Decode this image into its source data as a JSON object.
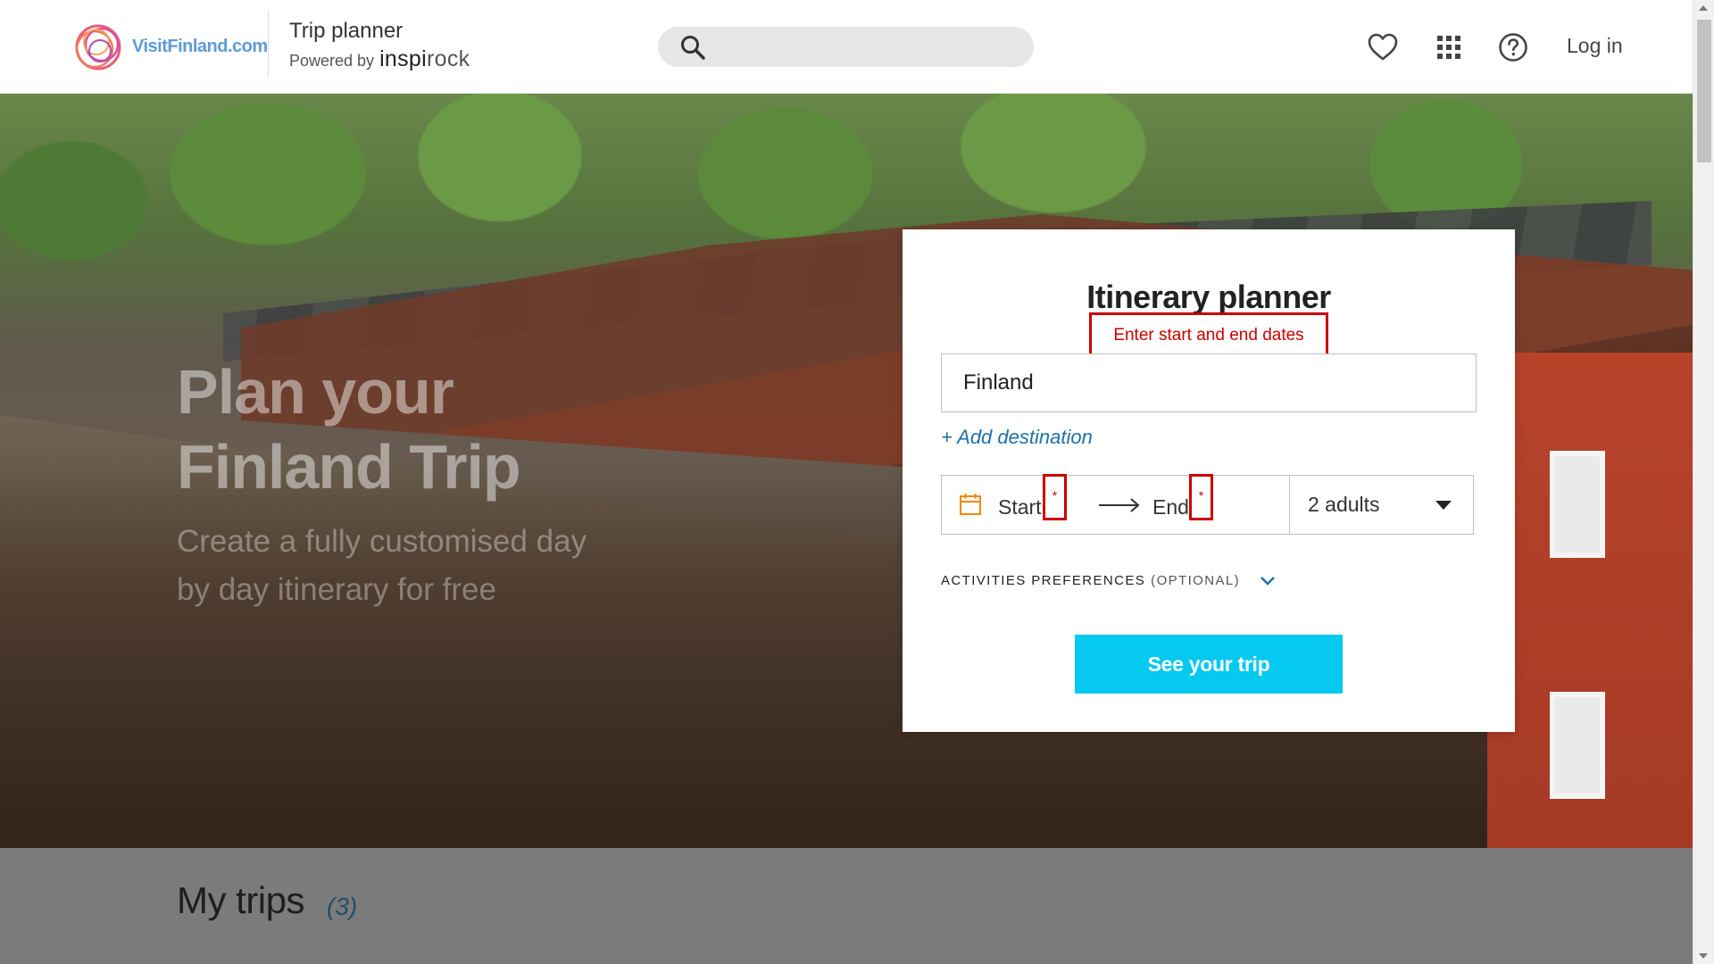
{
  "header": {
    "brand_text": "VisitFinland.com",
    "planner_title": "Trip planner",
    "powered_by": "Powered by",
    "inspi": "inspi",
    "rock": "rock",
    "search_placeholder": "",
    "login_label": "Log in",
    "icons": [
      "heart-icon",
      "apps-grid-icon",
      "help-icon",
      "search-icon"
    ]
  },
  "hero": {
    "title": "Plan your Finland Trip",
    "subtitle": "Create a fully customised day by day itinerary for free"
  },
  "planner": {
    "title": "Itinerary planner",
    "error": "Enter start and end dates",
    "destination_value": "Finland",
    "add_destination": "+ Add destination",
    "start_label": "Start",
    "end_label": "End",
    "required_mark": "*",
    "travellers": "2 adults",
    "activities_label": "ACTIVITIES PREFERENCES",
    "activities_optional": "(OPTIONAL)",
    "submit_label": "See your trip"
  },
  "my_trips": {
    "title": "My trips",
    "count": "(3)"
  },
  "colors": {
    "accent": "#06c9f0",
    "error": "#cc0000",
    "link": "#1f6fa8",
    "calendar": "#f08a00"
  }
}
